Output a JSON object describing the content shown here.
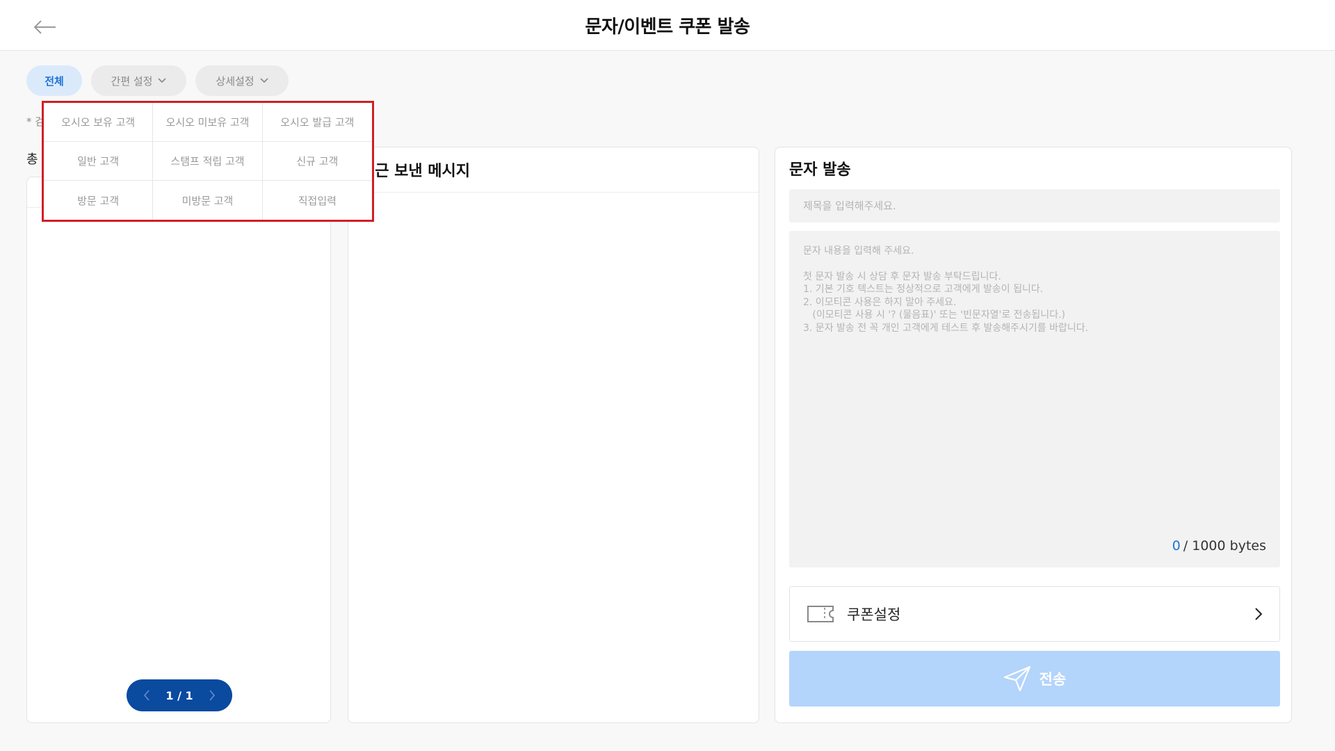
{
  "header": {
    "title": "문자/이벤트 쿠폰 발송",
    "back_icon": "arrow-left-icon"
  },
  "filters": {
    "all_label": "전체",
    "simple_label": "간편 설정",
    "detail_label": "상세설정"
  },
  "left_panel": {
    "note_prefix": "* 검",
    "total_prefix": "총",
    "pager_text": "1 / 1"
  },
  "middle_panel": {
    "title": "최근 보낸 메시지"
  },
  "right_panel": {
    "title": "문자 발송",
    "subject_placeholder": "제목을 입력해주세요.",
    "body_placeholder_lines": [
      "문자 내용을 입력해 주세요.",
      "첫 문자 발송 시 상담 후 문자 발송 부탁드립니다.",
      "1. 기본 기호 텍스트는 정상적으로 고객에게 발송이 됩니다.",
      "2. 이모티콘 사용은 하지 말아 주세요.",
      "   (이모티콘 사용 시 '? (물음표)' 또는 '빈문자열'로 전송됩니다.)",
      "3. 문자 발송 전 꼭 개인 고객에게 테스트 후 발송해주시기를 바랍니다."
    ],
    "byte_current": "0",
    "byte_max": "/ 1000 bytes",
    "coupon_label": "쿠폰설정",
    "send_label": "전송"
  },
  "dropdown": {
    "items": [
      "오시오 보유 고객",
      "오시오 미보유 고객",
      "오시오 발급 고객",
      "일반 고객",
      "스탬프 적립 고객",
      "신규 고객",
      "방문 고객",
      "미방문 고객",
      "직접입력"
    ]
  },
  "colors": {
    "accent": "#1f73d8",
    "pager_bg": "#0a4a9f",
    "send_bg": "#b3d4fb",
    "highlight_border": "#d11f26"
  }
}
